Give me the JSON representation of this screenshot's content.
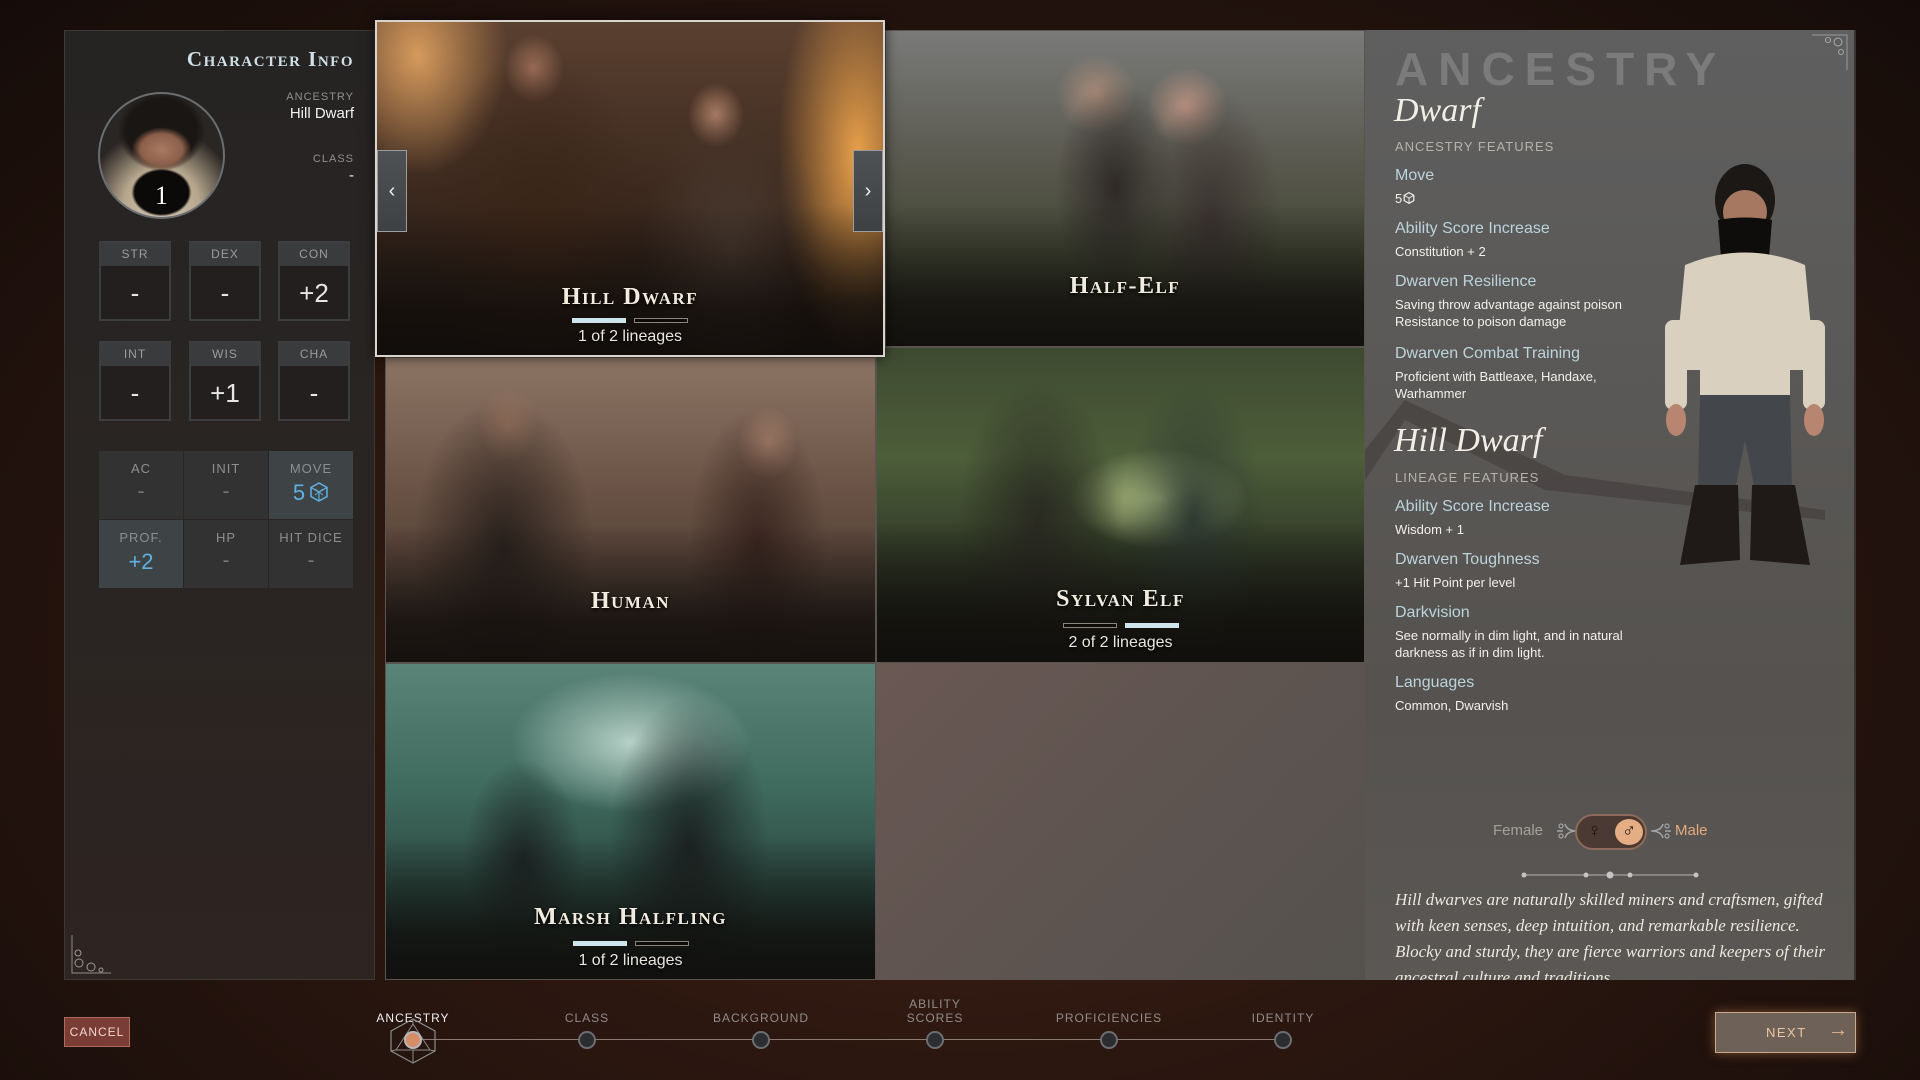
{
  "character_info": {
    "title": "Character Info",
    "level": "1",
    "ancestry_label": "ANCESTRY",
    "ancestry_value": "Hill Dwarf",
    "class_label": "CLASS",
    "class_value": "-",
    "abilities": [
      {
        "label": "STR",
        "value": "-"
      },
      {
        "label": "DEX",
        "value": "-"
      },
      {
        "label": "CON",
        "value": "+2"
      },
      {
        "label": "INT",
        "value": "-"
      },
      {
        "label": "WIS",
        "value": "+1"
      },
      {
        "label": "CHA",
        "value": "-"
      }
    ],
    "combat": [
      {
        "label": "AC",
        "value": "-"
      },
      {
        "label": "INIT",
        "value": "-"
      },
      {
        "label": "MOVE",
        "value": "5"
      },
      {
        "label": "PROF.",
        "value": "+2"
      },
      {
        "label": "HP",
        "value": "-"
      },
      {
        "label": "HIT DICE",
        "value": "-"
      }
    ]
  },
  "ancestry_cards": [
    {
      "name": "Hill Dwarf",
      "lineage_text": "1 of 2 lineages",
      "lineage_index": 1,
      "lineage_total": 2,
      "selected": true
    },
    {
      "name": "Half-Elf"
    },
    {
      "name": "Human"
    },
    {
      "name": "Sylvan Elf",
      "lineage_text": "2 of 2 lineages",
      "lineage_index": 2,
      "lineage_total": 2
    },
    {
      "name": "Marsh Halfling",
      "lineage_text": "1 of 2 lineages",
      "lineage_index": 1,
      "lineage_total": 2
    }
  ],
  "card_nav": {
    "prev": "‹",
    "next": "›"
  },
  "detail": {
    "heading": "ANCESTRY",
    "race": "Dwarf",
    "ancestry_features_label": "ANCESTRY FEATURES",
    "ancestry_features": [
      {
        "title": "Move",
        "text": "5"
      },
      {
        "title": "Ability Score Increase",
        "text": "Constitution + 2"
      },
      {
        "title": "Dwarven Resilience",
        "text": "Saving throw advantage against poison\nResistance to poison damage"
      },
      {
        "title": "Dwarven Combat Training",
        "text": "Proficient with Battleaxe, Handaxe, Warhammer"
      }
    ],
    "lineage": "Hill Dwarf",
    "lineage_features_label": "LINEAGE FEATURES",
    "lineage_features": [
      {
        "title": "Ability Score Increase",
        "text": "Wisdom + 1"
      },
      {
        "title": "Dwarven Toughness",
        "text": "+1 Hit Point per level"
      },
      {
        "title": "Darkvision",
        "text": "See normally in dim light, and in natural darkness as if in dim light."
      },
      {
        "title": "Languages",
        "text": "Common, Dwarvish"
      }
    ],
    "gender": {
      "female_label": "Female",
      "male_label": "Male",
      "selected": "Male",
      "female_symbol": "♀",
      "male_symbol": "♂"
    },
    "flavor_text": "Hill dwarves are naturally skilled miners and craftsmen, gifted with keen senses, deep intuition, and remarkable resilience. Blocky and sturdy, they are fierce warriors and keepers of their ancestral culture and traditions."
  },
  "footer": {
    "cancel_label": "CANCEL",
    "next_label": "NEXT",
    "next_arrow": "→",
    "steps": [
      {
        "label": "ANCESTRY",
        "active": true
      },
      {
        "label": "CLASS"
      },
      {
        "label": "BACKGROUND"
      },
      {
        "label": "ABILITY SCORES"
      },
      {
        "label": "PROFICIENCIES"
      },
      {
        "label": "IDENTITY"
      }
    ]
  },
  "colors": {
    "accent_blue": "#5eb1e0",
    "accent_copper": "#e4ad84",
    "cancel_red": "#7a3d35",
    "feature_title": "#bcd3dc"
  }
}
